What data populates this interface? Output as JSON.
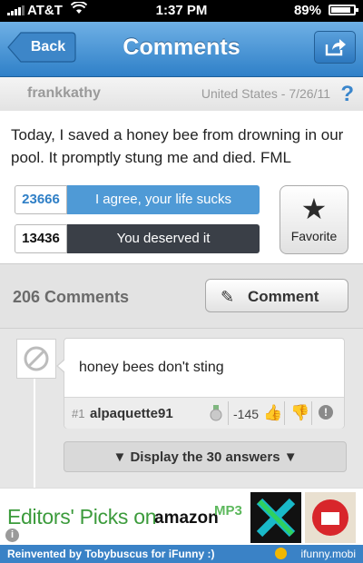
{
  "status_bar": {
    "carrier": "AT&T",
    "time": "1:37 PM",
    "battery": "89%",
    "battery_level": 0.89
  },
  "nav": {
    "back_label": "Back",
    "title": "Comments",
    "share_icon": "share-icon"
  },
  "meta": {
    "username": "frankkathy",
    "location_date": "United States - 7/26/11",
    "help_icon": "?"
  },
  "story": {
    "text": "Today, I saved a honey bee from drowning in our pool. It promptly stung me and died. FML",
    "agree_count": "23666",
    "agree_label": "I agree, your life sucks",
    "deserved_count": "13436",
    "deserved_label": "You deserved it",
    "favorite_label": "Favorite"
  },
  "comments": {
    "count_label": "206 Comments",
    "comment_button_label": "Comment",
    "items": [
      {
        "text": "honey bees don't sting",
        "number": "#1",
        "author": "alpaquette91",
        "score": "-145"
      }
    ],
    "answers_label": "Display the 30 answers"
  },
  "ad": {
    "text": "Editors' Picks on",
    "brand": "amazon",
    "brand_suffix": "MP3"
  },
  "footer": {
    "left": "Reinvented by Tobybuscus for iFunny :)",
    "right": "ifunny.mobi"
  },
  "colors": {
    "nav_blue": "#2f80c8",
    "agree_blue": "#4f9ad6",
    "deserved_dark": "#3a3f47",
    "footer_blue": "#3a82c6"
  }
}
